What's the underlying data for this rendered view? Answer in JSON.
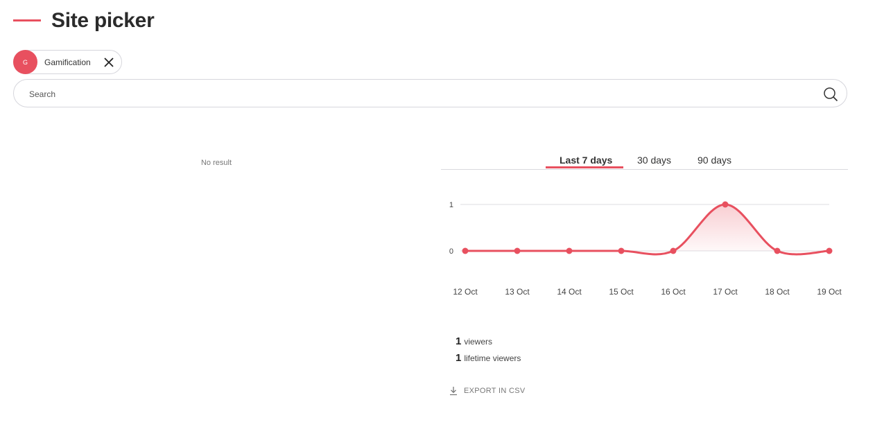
{
  "page": {
    "title": "Site picker"
  },
  "selected_site": {
    "initial": "G",
    "name": "Gamification"
  },
  "search": {
    "placeholder": "Search"
  },
  "results": {
    "empty_text": "No result"
  },
  "tabs": [
    {
      "label": "Last 7 days",
      "active": true
    },
    {
      "label": "30 days",
      "active": false
    },
    {
      "label": "90 days",
      "active": false
    }
  ],
  "colors": {
    "accent": "#e8505f",
    "text": "#333333",
    "border": "#d6d6dc"
  },
  "chart_data": {
    "type": "area",
    "categories": [
      "12 Oct",
      "13 Oct",
      "14 Oct",
      "15 Oct",
      "16 Oct",
      "17 Oct",
      "18 Oct",
      "19 Oct"
    ],
    "values": [
      0,
      0,
      0,
      0,
      0,
      1,
      0,
      0
    ],
    "y_ticks": [
      0,
      1
    ],
    "ylim": [
      0,
      1
    ],
    "grid": true,
    "legend": "none"
  },
  "stats": {
    "viewers": {
      "value": "1",
      "label": "viewers"
    },
    "lifetime": {
      "value": "1",
      "label": "lifetime viewers"
    }
  },
  "export": {
    "label": "EXPORT IN CSV"
  }
}
